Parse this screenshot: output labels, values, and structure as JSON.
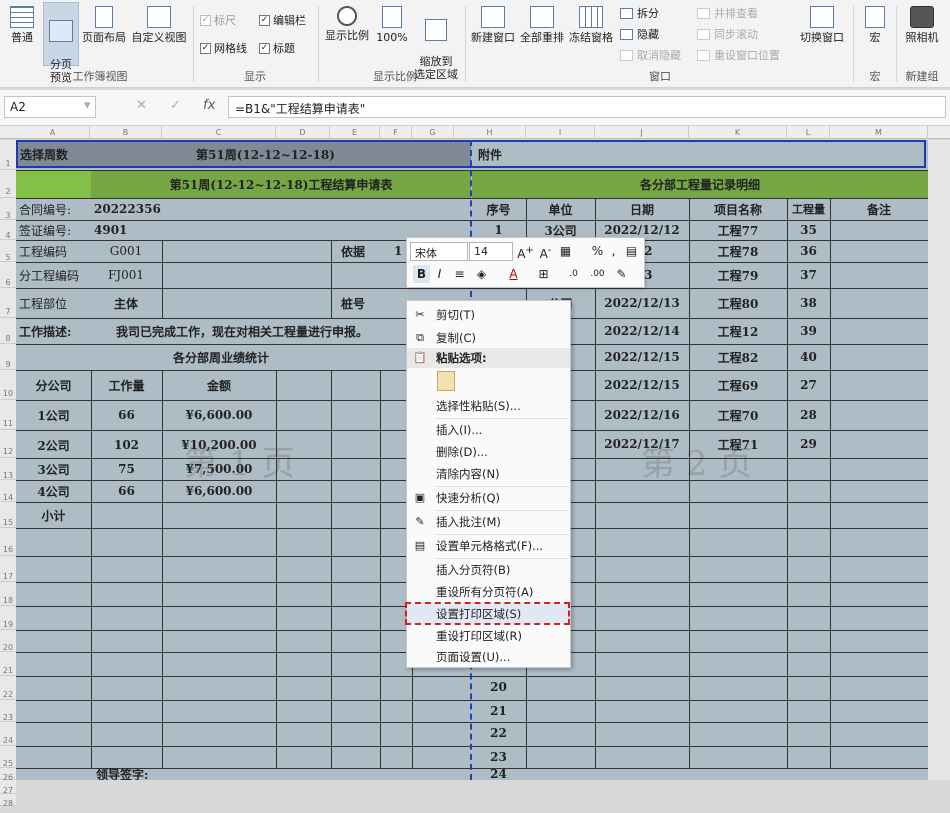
{
  "ribbon": {
    "workbook_views": {
      "normal": "普通",
      "page_break_preview": "分页\n预览",
      "page_layout": "页面布局",
      "custom_views": "自定义视图",
      "group": "工作簿视图"
    },
    "show": {
      "ruler": "标尺",
      "gridlines": "网格线",
      "formula_bar": "编辑栏",
      "headings": "标题",
      "group": "显示"
    },
    "zoom": {
      "zoom": "显示比例",
      "hundred": "100%",
      "zoom_selection": "缩放到\n选定区域",
      "group": "显示比例"
    },
    "window": {
      "new_window": "新建窗口",
      "arrange_all": "全部重排",
      "freeze_panes": "冻结窗格",
      "split": "拆分",
      "hide": "隐藏",
      "unhide": "取消隐藏",
      "side_by_side": "并排查看",
      "sync_scroll": "同步滚动",
      "reset_position": "重设窗口位置",
      "switch_windows": "切换窗口",
      "group": "窗口"
    },
    "macros": {
      "macros": "宏",
      "group": "宏"
    },
    "camera": {
      "label": "照相机",
      "group": "新建组"
    }
  },
  "formula_bar": {
    "name_box": "A2",
    "formula": "=B1&\"工程结算申请表\""
  },
  "columns": [
    "A",
    "B",
    "C",
    "D",
    "E",
    "F",
    "G",
    "H",
    "I",
    "J",
    "K",
    "L",
    "M"
  ],
  "rows": [
    "1",
    "2",
    "3",
    "4",
    "5",
    "6",
    "7",
    "8",
    "9",
    "10",
    "11",
    "12",
    "13",
    "14",
    "15",
    "16",
    "17",
    "18",
    "19",
    "20",
    "21",
    "22",
    "23",
    "24",
    "25",
    "26",
    "27",
    "28"
  ],
  "sheet": {
    "r1_a": "选择周数",
    "r1_c": "第51周(12-12~12-18)",
    "r1_h": "附件",
    "r2_title": "第51周(12-12~12-18)工程结算申请表",
    "r2_right": "各分部工程量记录明细",
    "contract_label": "合同编号:",
    "contract_val": "20222356",
    "visa_label": "签证编号:",
    "visa_val": "4901",
    "proj_code_label": "工程编码",
    "proj_code_val": "G001",
    "basis_label": "依据",
    "basis_val": "1",
    "sub_code_label": "分工程编码",
    "sub_code_val": "FJ001",
    "dept_label": "工程部位",
    "dept_val": "主体",
    "pile_label": "桩号",
    "desc_label": "工作描述:",
    "desc_val": "我司已完成工作，现在对相关工程量进行申报。",
    "weekly_title": "各分部周业绩统计",
    "hdr_company": "分公司",
    "hdr_work": "工作量",
    "hdr_amount": "金额",
    "companies": [
      {
        "name": "1公司",
        "work": "66",
        "amount": "¥6,600.00"
      },
      {
        "name": "2公司",
        "work": "102",
        "amount": "¥10,200.00"
      },
      {
        "name": "3公司",
        "work": "75",
        "amount": "¥7,500.00"
      },
      {
        "name": "4公司",
        "work": "66",
        "amount": "¥6,600.00"
      }
    ],
    "subtotal": "小计",
    "sign": "领导签字:_____________________",
    "rhdr_no": "序号",
    "rhdr_unit": "单位",
    "rhdr_date": "日期",
    "rhdr_proj": "项目名称",
    "rhdr_qty": "工程量",
    "rhdr_note": "备注",
    "records": [
      {
        "no": "1",
        "unit": "3公司",
        "date": "2022/12/12",
        "proj": "工程77",
        "qty": "35"
      },
      {
        "no": "",
        "unit": "",
        "date": "/12",
        "proj": "工程78",
        "qty": "36"
      },
      {
        "no": "",
        "unit": "",
        "date": "/13",
        "proj": "工程79",
        "qty": "37"
      },
      {
        "no": "",
        "unit": "公司",
        "date": "2022/12/13",
        "proj": "工程80",
        "qty": "38"
      },
      {
        "no": "",
        "unit": "司",
        "date": "2022/12/14",
        "proj": "工程12",
        "qty": "39"
      },
      {
        "no": "",
        "unit": "司",
        "date": "2022/12/15",
        "proj": "工程82",
        "qty": "40"
      },
      {
        "no": "",
        "unit": "司",
        "date": "2022/12/15",
        "proj": "工程69",
        "qty": "27"
      },
      {
        "no": "",
        "unit": "司",
        "date": "2022/12/16",
        "proj": "工程70",
        "qty": "28"
      },
      {
        "no": "",
        "unit": "司",
        "date": "2022/12/17",
        "proj": "工程71",
        "qty": "29"
      }
    ],
    "seq_more": [
      "20",
      "21",
      "22",
      "23",
      "24"
    ],
    "wm1": "第 1 页",
    "wm2": "第 2 页"
  },
  "mini_toolbar": {
    "font": "宋体",
    "size": "14",
    "bold": "B",
    "italic": "I"
  },
  "context_menu": {
    "cut": "剪切(T)",
    "copy": "复制(C)",
    "paste_options": "粘贴选项:",
    "paste_special": "选择性粘贴(S)...",
    "insert": "插入(I)...",
    "delete": "删除(D)...",
    "clear": "清除内容(N)",
    "quick_analysis": "快速分析(Q)",
    "insert_comment": "插入批注(M)",
    "format_cells": "设置单元格格式(F)...",
    "insert_page_break": "插入分页符(B)",
    "reset_page_breaks": "重设所有分页符(A)",
    "set_print_area": "设置打印区域(S)",
    "reset_print_area": "重设打印区域(R)",
    "page_setup": "页面设置(U)..."
  }
}
